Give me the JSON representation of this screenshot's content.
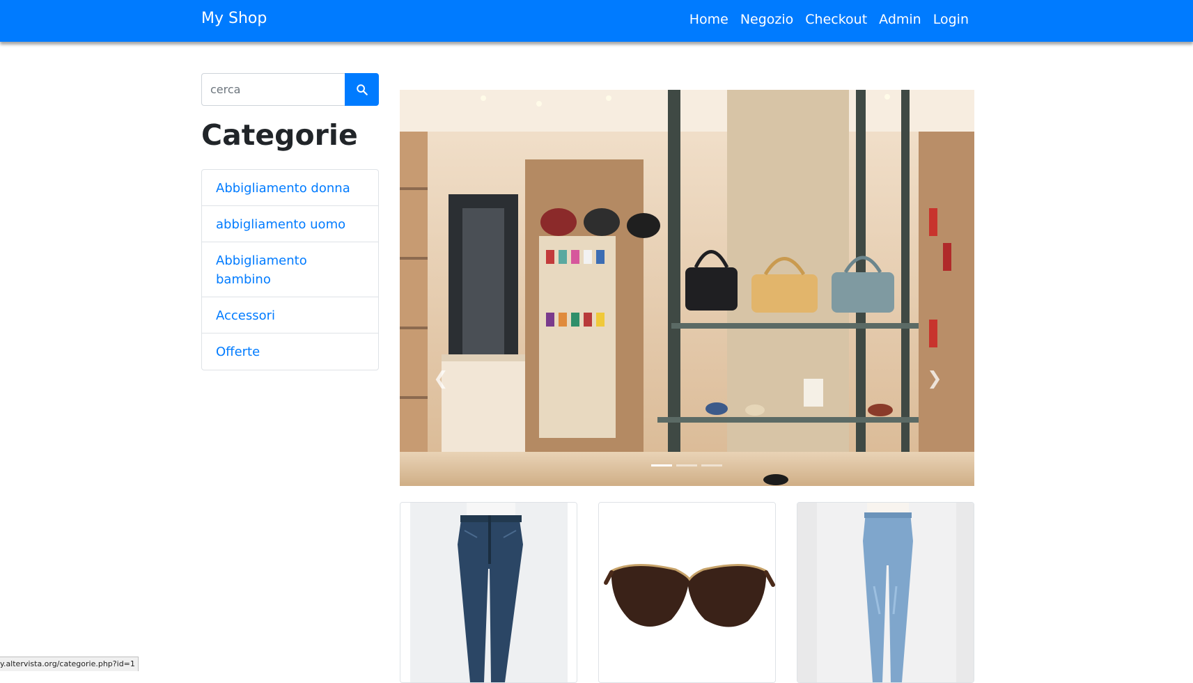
{
  "navbar": {
    "brand": "My Shop",
    "links": [
      "Home",
      "Negozio",
      "Checkout",
      "Admin",
      "Login"
    ],
    "background": "#007bff"
  },
  "search": {
    "placeholder": "cerca",
    "button_icon": "search-icon"
  },
  "categories": {
    "title": "Categorie",
    "items": [
      "Abbigliamento donna",
      "abbigliamento uomo",
      "Abbigliamento bambino",
      "Accessori",
      "Offerte"
    ]
  },
  "carousel": {
    "slide_count": 3,
    "active_index": 0,
    "prev_icon": "chevron-left-icon",
    "next_icon": "chevron-right-icon",
    "prev_glyph": "❮",
    "next_glyph": "❯"
  },
  "products": [
    {
      "image": "men-jeans"
    },
    {
      "image": "sunglasses"
    },
    {
      "image": "women-jeans"
    }
  ],
  "status_bar": {
    "url": "y.altervista.org/categorie.php?id=1"
  },
  "colors": {
    "accent": "#007bff",
    "text_dark": "#212529",
    "border": "#dee2e6"
  }
}
